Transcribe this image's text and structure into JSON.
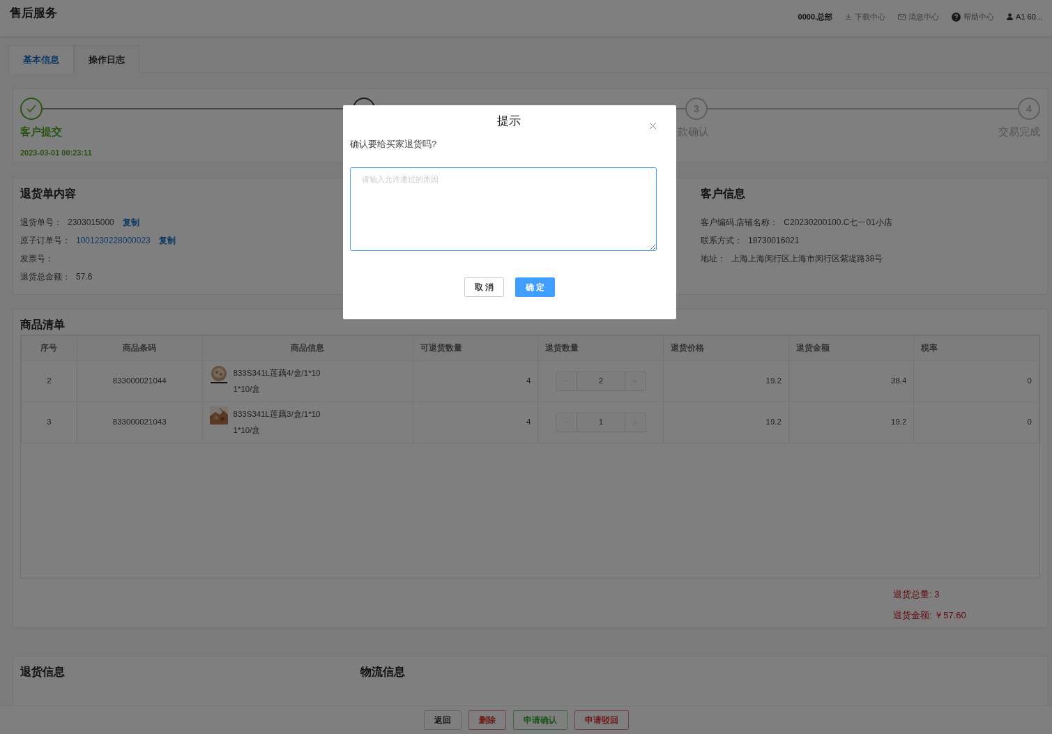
{
  "header": {
    "title": "售后服务",
    "org": "0000.总部",
    "links": [
      {
        "kind": "download",
        "label": "下载中心"
      },
      {
        "kind": "mail",
        "label": "消息中心"
      },
      {
        "kind": "help",
        "label": "帮助中心"
      },
      {
        "kind": "user",
        "label": "A1 60..."
      }
    ]
  },
  "tabs": [
    {
      "label": "基本信息",
      "selected": true
    },
    {
      "label": "操作日志",
      "selected": false
    }
  ],
  "steps": [
    {
      "kind": "done",
      "label": "客户提交",
      "time": "2023-03-01 00:23:11"
    },
    {
      "kind": "current"
    },
    {
      "kind": "todo",
      "number": "3",
      "label": "款确认"
    },
    {
      "kind": "todo",
      "number": "4",
      "label": "交易完成"
    }
  ],
  "return_order": {
    "title": "退货单内容",
    "fields": [
      {
        "label": "退货单号：",
        "value": "2303015000",
        "link": false,
        "action": "复制"
      },
      {
        "label": "原子订单号：",
        "value": "1001230228000023",
        "link": true,
        "action": "复制"
      },
      {
        "label": "发票号："
      },
      {
        "label": "退货总金额：",
        "value": "57.6",
        "link": false
      }
    ]
  },
  "customer": {
    "title": "客户信息",
    "fields": [
      {
        "label": "客户编码.店铺名称：",
        "value": "C20230200100.C七一01小店"
      },
      {
        "label": "联系方式：",
        "value": "18730016021"
      },
      {
        "label": "地址：",
        "value": "上海上海闵行区上海市闵行区紫堤路38号"
      }
    ]
  },
  "goods": {
    "title": "商品清单",
    "columns": [
      "序号",
      "商品条码",
      "商品信息",
      "可退货数量",
      "退货数量",
      "退货价格",
      "退货金额",
      "税率"
    ],
    "rows": [
      {
        "index": "2",
        "barcode": "833000021044",
        "name": "833S341L莲藕4/盒/1*10",
        "spec": "1*10/盒",
        "available": "4",
        "quantity": "2",
        "price": "19.2",
        "amount": "38.4",
        "tax": "0"
      },
      {
        "index": "3",
        "barcode": "833000021043",
        "name": "833S341L莲藕3/盒/1*10",
        "spec": "1*10/盒",
        "available": "4",
        "quantity": "1",
        "price": "19.2",
        "amount": "19.2",
        "tax": "0"
      }
    ],
    "totals": [
      "退货总量: 3",
      "退货金额: ￥57.60"
    ]
  },
  "bottom_sections": [
    "退货信息",
    "物流信息"
  ],
  "footer_buttons": [
    {
      "label": "返回",
      "kind": "default"
    },
    {
      "label": "删除",
      "kind": "danger"
    },
    {
      "label": "申请确认",
      "kind": "success"
    },
    {
      "label": "申请驳回",
      "kind": "danger"
    }
  ],
  "dialog": {
    "title": "提示",
    "message": "确认要给买家退货吗?",
    "placeholder": "请输入允许通过的原因",
    "buttons": [
      {
        "label": "取 消",
        "kind": "default"
      },
      {
        "label": "确 定",
        "kind": "primary"
      }
    ]
  }
}
